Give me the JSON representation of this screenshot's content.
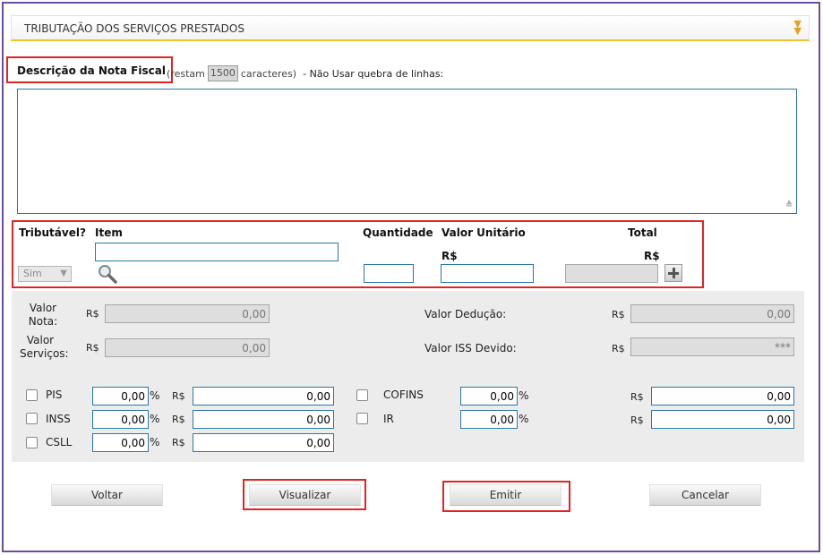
{
  "section": {
    "title": "TRIBUTAÇÃO DOS SERVIÇOS PRESTADOS"
  },
  "description": {
    "label": "Descrição da Nota Fiscal",
    "note_prefix": "(restam",
    "remaining": "1500",
    "note_suffix": "caracteres)",
    "note_rest": "- Não Usar quebra de linhas:",
    "value": ""
  },
  "items": {
    "headers": {
      "taxable": "Tributável?",
      "item": "Item",
      "quantity": "Quantidade",
      "unit_value": "Valor Unitário",
      "total": "Total"
    },
    "currency": "R$",
    "taxable_selected": "Sim",
    "item_value": "",
    "quantity_value": "",
    "unit_value_value": "",
    "total_value": ""
  },
  "totals": {
    "valor_nota": {
      "label": "Valor Nota:",
      "currency": "R$",
      "value": "0,00"
    },
    "valor_servicos": {
      "label": "Valor Serviços:",
      "currency": "R$",
      "value": "0,00"
    },
    "valor_deducao": {
      "label": "Valor Dedução:",
      "currency": "R$",
      "value": "0,00"
    },
    "valor_iss": {
      "label": "Valor ISS Devido:",
      "currency": "R$",
      "value": "***"
    }
  },
  "taxes": {
    "percent_sign": "%",
    "currency": "R$",
    "pis": {
      "label": "PIS",
      "percent": "0,00",
      "amount": "0,00"
    },
    "inss": {
      "label": "INSS",
      "percent": "0,00",
      "amount": "0,00"
    },
    "csll": {
      "label": "CSLL",
      "percent": "0,00",
      "amount": "0,00"
    },
    "cofins": {
      "label": "COFINS",
      "percent": "0,00",
      "amount": "0,00"
    },
    "ir": {
      "label": "IR",
      "percent": "0,00",
      "amount": "0,00"
    }
  },
  "actions": {
    "back": "Voltar",
    "preview": "Visualizar",
    "issue": "Emitir",
    "cancel": "Cancelar"
  },
  "colors": {
    "highlight": "#e32222",
    "accent": "#f3c22e",
    "frame": "#6a4c9c",
    "input_border": "#2878a8"
  }
}
